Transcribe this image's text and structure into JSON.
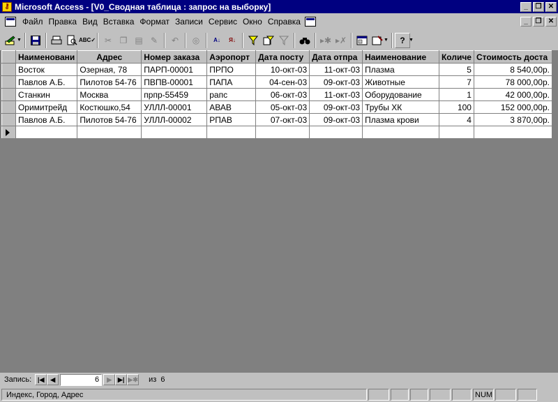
{
  "window": {
    "title": "Microsoft Access - [V0_Сводная таблица : запрос на выборку]",
    "app_icon": "access-key-icon"
  },
  "menu": {
    "items": [
      "Файл",
      "Правка",
      "Вид",
      "Вставка",
      "Формат",
      "Записи",
      "Сервис",
      "Окно",
      "Справка"
    ]
  },
  "toolbar": {
    "icons": [
      "design-view-icon",
      "save-icon",
      "print-icon",
      "print-preview-icon",
      "spelling-icon",
      "cut-icon",
      "copy-icon",
      "paste-icon",
      "format-painter-icon",
      "undo-icon",
      "hyperlink-icon",
      "sort-ascending-icon",
      "sort-descending-icon",
      "filter-by-selection-icon",
      "filter-by-form-icon",
      "apply-filter-icon",
      "find-icon",
      "new-record-icon",
      "delete-record-icon",
      "database-window-icon",
      "new-object-icon",
      "help-icon"
    ]
  },
  "datasheet": {
    "columns": [
      "Наименовани",
      "Адрес",
      "Номер заказа",
      "Аэропорт",
      "Дата посту",
      "Дата отпра",
      "Наименование",
      "Количе",
      "Стоимость доста"
    ],
    "rows": [
      [
        "Восток",
        "Озерная, 78",
        "ПАРП-00001",
        "ПРПО",
        "10-окт-03",
        "11-окт-03",
        "Плазма",
        "5",
        "8 540,00р."
      ],
      [
        "Павлов А.Б.",
        "Пилотов 54-76",
        "ПВПВ-00001",
        "ПАПА",
        "04-сен-03",
        "09-окт-03",
        "Животные",
        "7",
        "78 000,00р."
      ],
      [
        "Станкин",
        "Москва",
        "прпр-55459",
        "рапс",
        "06-окт-03",
        "11-окт-03",
        "Оборудование",
        "1",
        "42 000,00р."
      ],
      [
        "Оримитрейд",
        "Костюшко,54",
        "УЛЛЛ-00001",
        "АВАВ",
        "05-окт-03",
        "09-окт-03",
        "Трубы ХК",
        "100",
        "152 000,00р."
      ],
      [
        "Павлов А.Б.",
        "Пилотов 54-76",
        "УЛЛЛ-00002",
        "РПАВ",
        "07-окт-03",
        "09-окт-03",
        "Плазма крови",
        "4",
        "3 870,00р."
      ]
    ]
  },
  "navigation": {
    "label": "Запись:",
    "current_record": "6",
    "of_label": "из",
    "total_records": "6"
  },
  "statusbar": {
    "text": "Индекс, Город, Адрес",
    "num_indicator": "NUM"
  }
}
